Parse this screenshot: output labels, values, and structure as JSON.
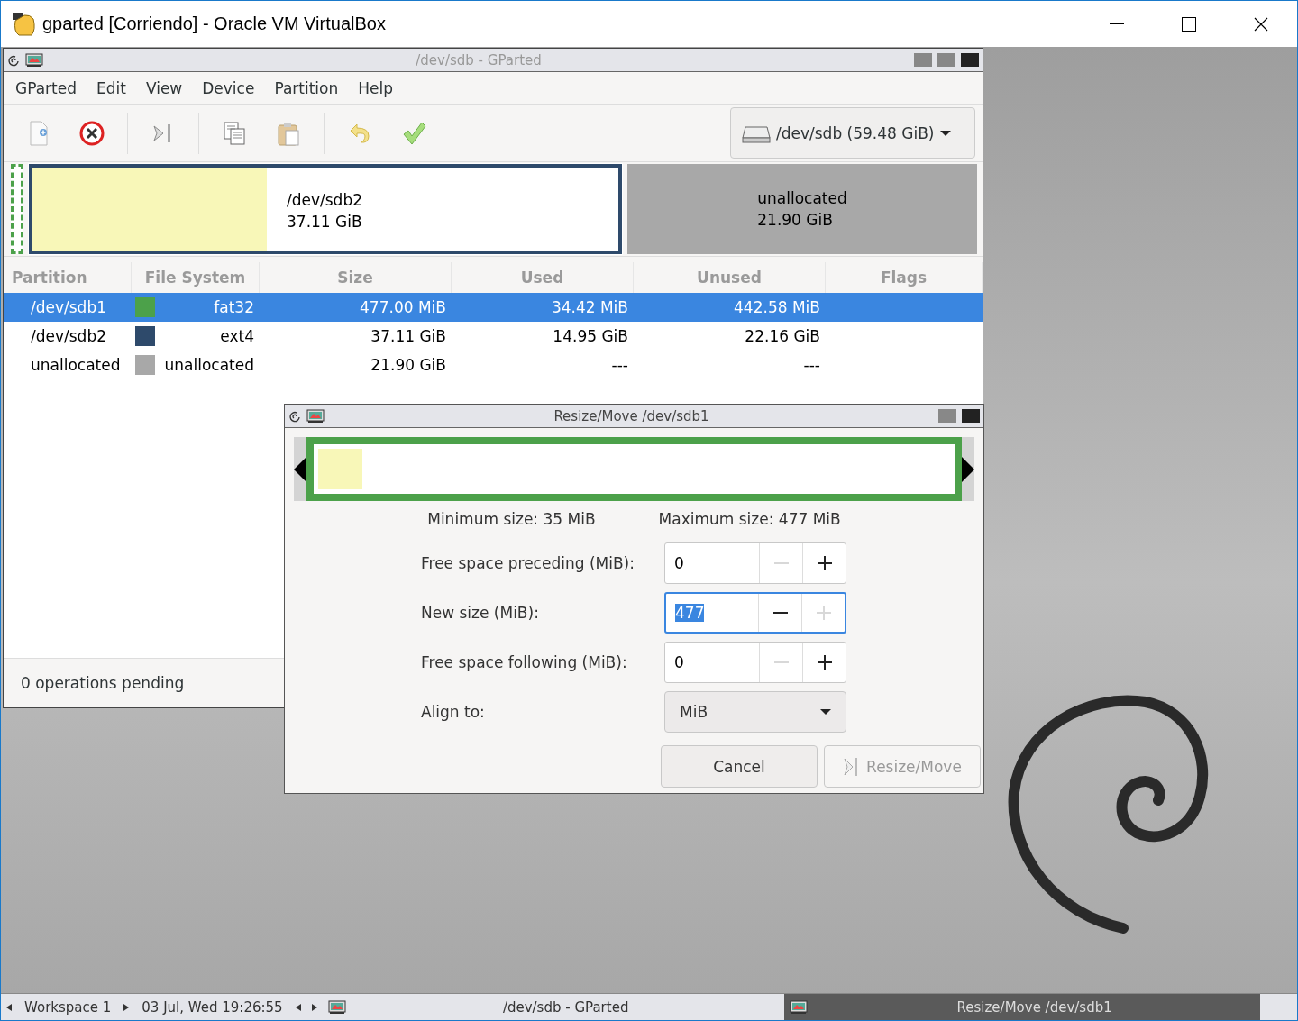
{
  "window": {
    "title": "gparted [Corriendo] - Oracle VM VirtualBox"
  },
  "gparted": {
    "title": "/dev/sdb - GParted",
    "menu": [
      "GParted",
      "Edit",
      "View",
      "Device",
      "Partition",
      "Help"
    ],
    "device_selector": "/dev/sdb (59.48 GiB)",
    "disk_map": [
      {
        "kind": "partition",
        "color": "#4ca14a",
        "selected": true
      },
      {
        "kind": "partition",
        "color": "#2e4a6b",
        "selected": false,
        "level": 0.4,
        "name": "/dev/sdb2",
        "size": "37.11 GiB"
      },
      {
        "kind": "unallocated",
        "color": "#a8a8a8",
        "selected": false,
        "name": "unallocated",
        "size": "21.90 GiB"
      }
    ],
    "table": {
      "columns": [
        "Partition",
        "File System",
        "Size",
        "Used",
        "Unused",
        "Flags"
      ],
      "rows": [
        {
          "partition": "/dev/sdb1",
          "color": "#4ca14a",
          "file_system": "fat32",
          "size": "477.00 MiB",
          "used": "34.42 MiB",
          "unused": "442.58 MiB",
          "selected": true
        },
        {
          "partition": "/dev/sdb2",
          "color": "#2e4a6b",
          "file_system": "ext4",
          "size": "37.11 GiB",
          "used": "14.95 GiB",
          "unused": "22.16 GiB",
          "selected": false
        },
        {
          "partition": "unallocated",
          "color": "#a8a8a8",
          "file_system": "unallocated",
          "size": "21.90 GiB",
          "used": "---",
          "unused": "---",
          "selected": false
        }
      ]
    },
    "status": "0 operations pending"
  },
  "dialog": {
    "title": "Resize/Move /dev/sdb1",
    "map": {
      "level": 0.07,
      "color": "#4ca14a"
    },
    "minimum": "Minimum size: 35 MiB",
    "maximum": "Maximum size: 477 MiB",
    "fields": [
      {
        "label": "Free space preceding (MiB):",
        "value": "0",
        "focused": false,
        "minus_disabled": true,
        "plus_disabled": false
      },
      {
        "label": "New size (MiB):",
        "value": "477",
        "focused": true,
        "minus_disabled": false,
        "plus_disabled": true
      },
      {
        "label": "Free space following (MiB):",
        "value": "0",
        "focused": false,
        "minus_disabled": true,
        "plus_disabled": false
      }
    ],
    "align": {
      "label": "Align to:",
      "value": "MiB"
    },
    "buttons": [
      {
        "label": "Cancel",
        "disabled": false
      },
      {
        "label": "Resize/Move",
        "disabled": true
      }
    ]
  },
  "taskbar": {
    "workspace": "Workspace 1",
    "clock": "03 Jul, Wed 19:26:55",
    "tasks": [
      {
        "label": "/dev/sdb - GParted",
        "selected": false
      },
      {
        "label": "Resize/Move /dev/sdb1",
        "selected": true
      }
    ]
  }
}
